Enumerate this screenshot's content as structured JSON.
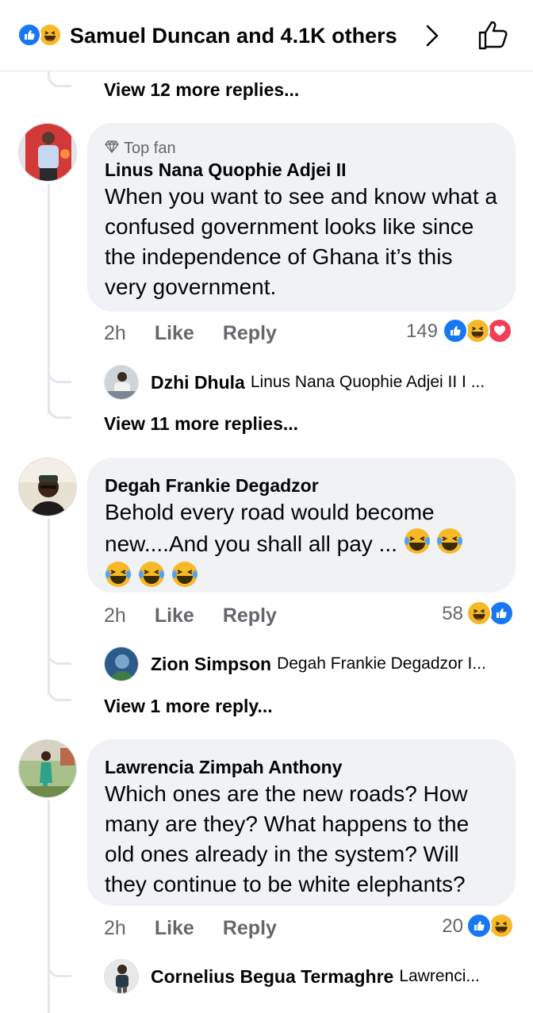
{
  "header": {
    "likers_text": "Samuel Duncan and 4.1K others",
    "reaction_icons": [
      "like-icon",
      "haha-icon"
    ],
    "chevron_icon": "chevron-right-icon",
    "like_action_icon": "thumbs-up-outline-icon"
  },
  "top_thread": {
    "view_more": "View 12 more replies..."
  },
  "comments": [
    {
      "badge": "Top fan",
      "badge_icon": "diamond-icon",
      "author": "Linus Nana Quophie Adjei II",
      "text": "When you want to see and know what a confused government looks like since the independence of Ghana it’s this very government.",
      "age": "2h",
      "like": "Like",
      "reply": "Reply",
      "reaction_count": "149",
      "reactions": [
        "like-icon",
        "haha-icon",
        "love-icon"
      ],
      "reply_preview": {
        "name": "Dzhi Dhula",
        "text": "Linus Nana Quophie Adjei II I ..."
      },
      "view_more": "View 11 more replies..."
    },
    {
      "author": "Degah Frankie Degadzor",
      "text": "Behold every road would become new....And you shall all pay ...",
      "emoji_line1_count": 2,
      "emoji_line2_count": 3,
      "emoji": "laughing-tears-emoji",
      "age": "2h",
      "like": "Like",
      "reply": "Reply",
      "reaction_count": "58",
      "reactions": [
        "haha-icon",
        "like-icon"
      ],
      "reply_preview": {
        "name": "Zion Simpson",
        "text": "Degah Frankie Degadzor I..."
      },
      "view_more": "View 1 more reply..."
    },
    {
      "author": "Lawrencia Zimpah Anthony",
      "text": "Which ones are the new roads? How many are they? What happens to the old ones already in the system? Will they continue to be white elephants?",
      "age": "2h",
      "like": "Like",
      "reply": "Reply",
      "reaction_count": "20",
      "reactions": [
        "like-icon",
        "haha-icon"
      ],
      "reply_preview": {
        "name": "Cornelius Begua Termaghre",
        "text": "Lawrenci..."
      }
    }
  ],
  "colors": {
    "like_blue": "#1877f2",
    "love_red": "#f33e58",
    "haha_yellow": "#f7b928",
    "bubble_gray": "#f0f2f5",
    "meta_gray": "#65676b"
  }
}
